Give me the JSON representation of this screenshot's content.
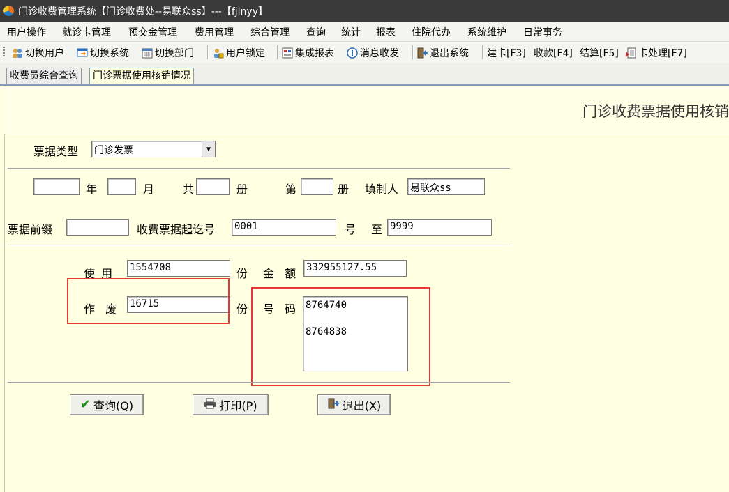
{
  "window": {
    "title": "门诊收费管理系统【门诊收费处--易联众ss】---【fjlnyy】"
  },
  "menu": [
    "用户操作",
    "就诊卡管理",
    "预交金管理",
    "费用管理",
    "综合管理",
    "查询",
    "统计",
    "报表",
    "住院代办",
    "系统维护",
    "日常事务"
  ],
  "toolbar": {
    "switch_user": "切换用户",
    "switch_system": "切换系统",
    "switch_dept": "切换部门",
    "user_lock": "用户锁定",
    "report": "集成报表",
    "message": "消息收发",
    "exit_system": "退出系统",
    "build_card": "建卡[F3]",
    "collect": "收款[F4]",
    "settle": "结算[F5]",
    "card_process": "卡处理[F7]"
  },
  "tabs": [
    {
      "label": "收费员综合查询",
      "active": false
    },
    {
      "label": "门诊票据使用核销情况",
      "active": true
    }
  ],
  "banner_title": "门诊收费票据使用核销",
  "form": {
    "bill_type_label": "票据类型",
    "bill_type_value": "门诊发票",
    "year_label": "年",
    "year_value": "",
    "month_label": "月",
    "month_value": "",
    "total_label": "共",
    "total_value": "",
    "book_label": "册",
    "index_label": "第",
    "index_value": "",
    "book_label2": "册",
    "maker_label": "填制人",
    "maker_value": "易联众ss",
    "prefix_label": "票据前缀",
    "prefix_value": "",
    "start_label": "收费票据起讫号",
    "start_value": "0001",
    "hao_label": "号",
    "to_label": "至",
    "end_value": "9999",
    "used_label": "使  用",
    "used_value": "1554708",
    "fen_label": "份",
    "amount_label": "金  额",
    "amount_value": "332955127.55",
    "void_label": "作  废",
    "void_value": "16715",
    "fen_label2": "份",
    "number_label": "号  码",
    "void_numbers": [
      "8764740",
      "8764838"
    ]
  },
  "buttons": {
    "query": "查询(Q)",
    "print": "打印(P)",
    "exit": "退出(X)"
  },
  "colors": {
    "highlight": "#e53935",
    "form_bg": "#ffffe1",
    "titlebar": "#3a3a3a"
  }
}
